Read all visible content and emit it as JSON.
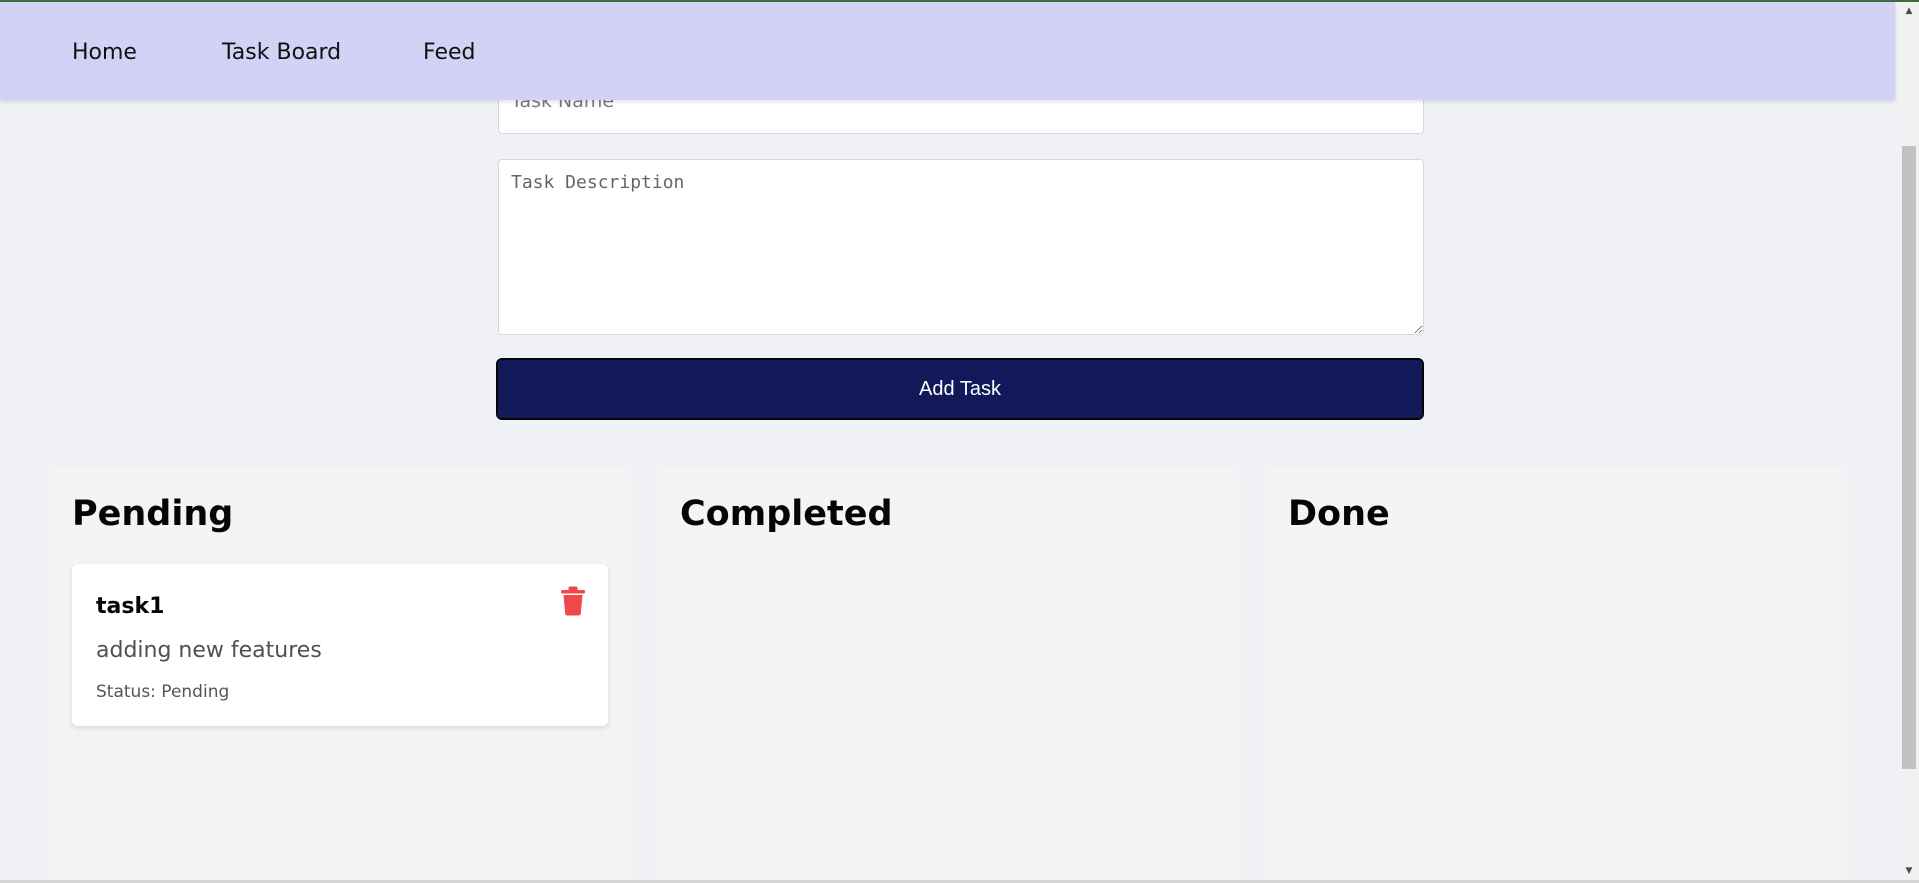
{
  "nav": {
    "items": [
      {
        "label": "Home"
      },
      {
        "label": "Task Board"
      },
      {
        "label": "Feed"
      }
    ]
  },
  "form": {
    "task_name_placeholder": "Task Name",
    "task_description_placeholder": "Task Description",
    "add_button_label": "Add Task"
  },
  "columns": [
    {
      "title": "Pending",
      "tasks": [
        {
          "name": "task1",
          "description": "adding new features",
          "status": "Status: Pending"
        }
      ]
    },
    {
      "title": "Completed",
      "tasks": []
    },
    {
      "title": "Done",
      "tasks": []
    }
  ],
  "icons": {
    "delete": "trash-icon",
    "scroll_up": "chevron-up-icon",
    "scroll_down": "chevron-down-icon"
  },
  "colors": {
    "navbar_bg": "#d1d2f6",
    "button_bg": "#12195a",
    "delete_icon": "#f0474a",
    "page_bg": "#f0f1f5"
  }
}
